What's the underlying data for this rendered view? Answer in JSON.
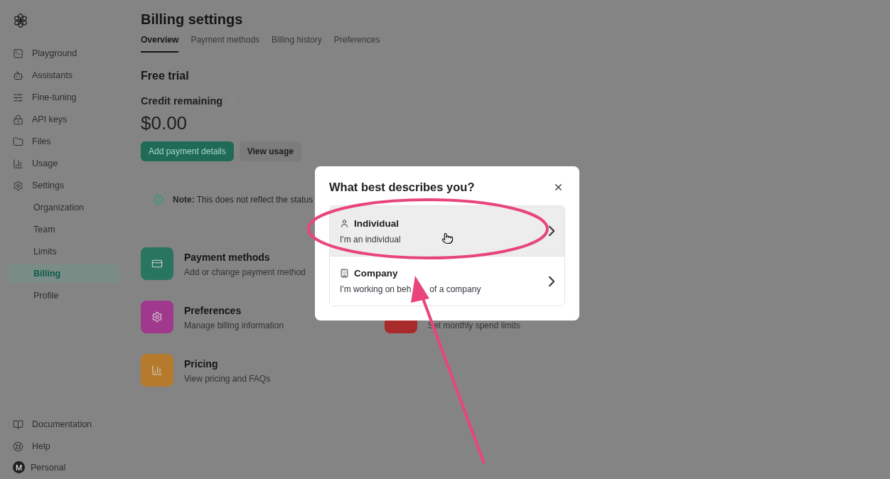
{
  "sidebar": {
    "items": [
      {
        "label": "Playground",
        "kind": "main",
        "selected": false
      },
      {
        "label": "Assistants",
        "kind": "main",
        "selected": false
      },
      {
        "label": "Fine-tuning",
        "kind": "main",
        "selected": false
      },
      {
        "label": "API keys",
        "kind": "main",
        "selected": false
      },
      {
        "label": "Files",
        "kind": "main",
        "selected": false
      },
      {
        "label": "Usage",
        "kind": "main",
        "selected": false
      },
      {
        "label": "Settings",
        "kind": "main",
        "selected": false
      },
      {
        "label": "Organization",
        "kind": "sub",
        "selected": false
      },
      {
        "label": "Team",
        "kind": "sub",
        "selected": false
      },
      {
        "label": "Limits",
        "kind": "sub",
        "selected": false
      },
      {
        "label": "Billing",
        "kind": "sub",
        "selected": true
      },
      {
        "label": "Profile",
        "kind": "sub",
        "selected": false
      }
    ],
    "footer": [
      {
        "label": "Documentation"
      },
      {
        "label": "Help"
      }
    ],
    "account": {
      "initial": "M",
      "label": "Personal"
    }
  },
  "page": {
    "title": "Billing settings",
    "tabs": [
      {
        "label": "Overview",
        "selected": true
      },
      {
        "label": "Payment methods",
        "selected": false
      },
      {
        "label": "Billing history",
        "selected": false
      },
      {
        "label": "Preferences",
        "selected": false
      }
    ],
    "section_title": "Free trial",
    "credit_label": "Credit remaining",
    "credit_value": "$0.00",
    "buttons": [
      {
        "label": "Add payment details",
        "kind": "primary"
      },
      {
        "label": "View usage",
        "kind": "secondary"
      }
    ],
    "note": "**Note:** This does not reflect the status",
    "cards": [
      {
        "title": "Payment methods",
        "subtitle": "Add or change payment method",
        "color": "#2a7560"
      },
      {
        "title": "Preferences",
        "subtitle": "Manage billing information",
        "color": "#a0398e"
      },
      {
        "subtitle": "Set monthly spend limits",
        "color": "#a82a2a"
      },
      {
        "title": "Pricing",
        "subtitle": "View pricing and FAQs",
        "color": "#b57a2c"
      }
    ]
  },
  "dialog": {
    "title": "What best describes you?",
    "options": [
      {
        "title": "Individual",
        "subtitle": [
          "I'm an individual"
        ],
        "kind": "person",
        "hovered": true
      },
      {
        "title": "Company",
        "subtitle": [
          "I'm working on beh",
          "of a company"
        ],
        "kind": "building",
        "hovered": false
      }
    ]
  }
}
